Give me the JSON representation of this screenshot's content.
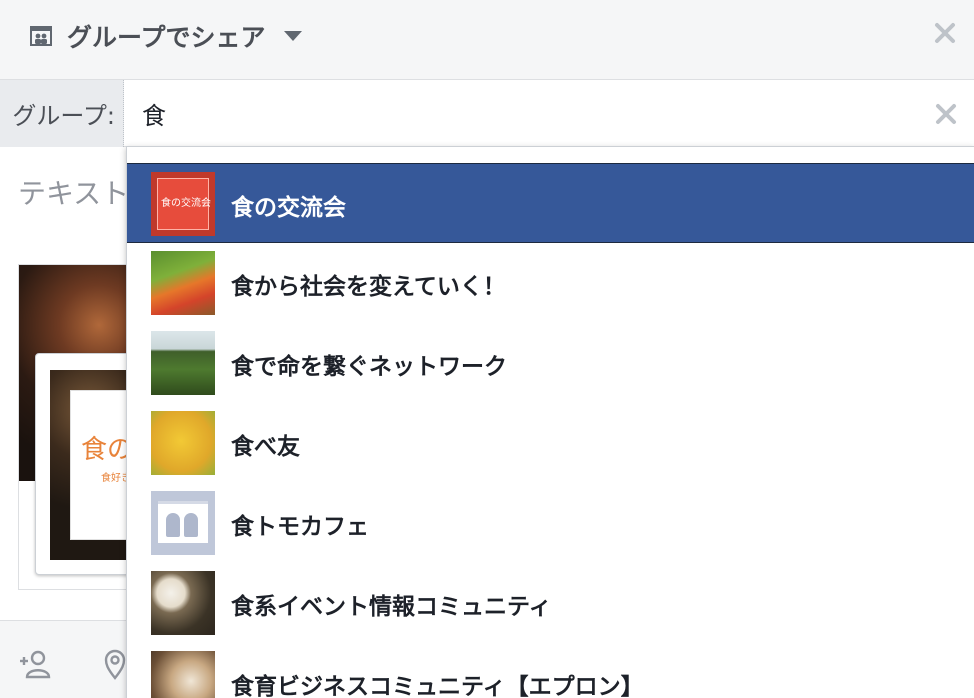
{
  "header": {
    "title": "グループでシェア",
    "group_icon": "group-icon",
    "caret_icon": "caret-down-icon",
    "close_icon": "close-icon"
  },
  "group_selector": {
    "label": "グループ:",
    "input_value": "食",
    "clear_icon": "close-icon"
  },
  "composer": {
    "placeholder": "テキスト",
    "preview_sign_text": "食の",
    "preview_sign_subtext": "食好き"
  },
  "dropdown": {
    "selected_index": 0,
    "items": [
      {
        "label": "食の交流会",
        "thumb": "red-poster",
        "thumb_text": "食の交流会"
      },
      {
        "label": "食から社会を変えていく！",
        "thumb": "vegetables"
      },
      {
        "label": "食で命を繋ぐネットワーク",
        "thumb": "field"
      },
      {
        "label": "食べ友",
        "thumb": "food-dish"
      },
      {
        "label": "食トモカフェ",
        "thumb": "default-group"
      },
      {
        "label": "食系イベント情報コミュニティ",
        "thumb": "meal-table"
      },
      {
        "label": "食育ビジネスコミュニティ【エプロン】",
        "thumb": "meal-table-2"
      }
    ]
  },
  "footer": {
    "icons": [
      "tag-people-icon",
      "location-pin-icon"
    ]
  },
  "colors": {
    "selected_bg": "#365899",
    "header_bg": "#f5f6f7",
    "label_bg": "#e9ebee"
  }
}
